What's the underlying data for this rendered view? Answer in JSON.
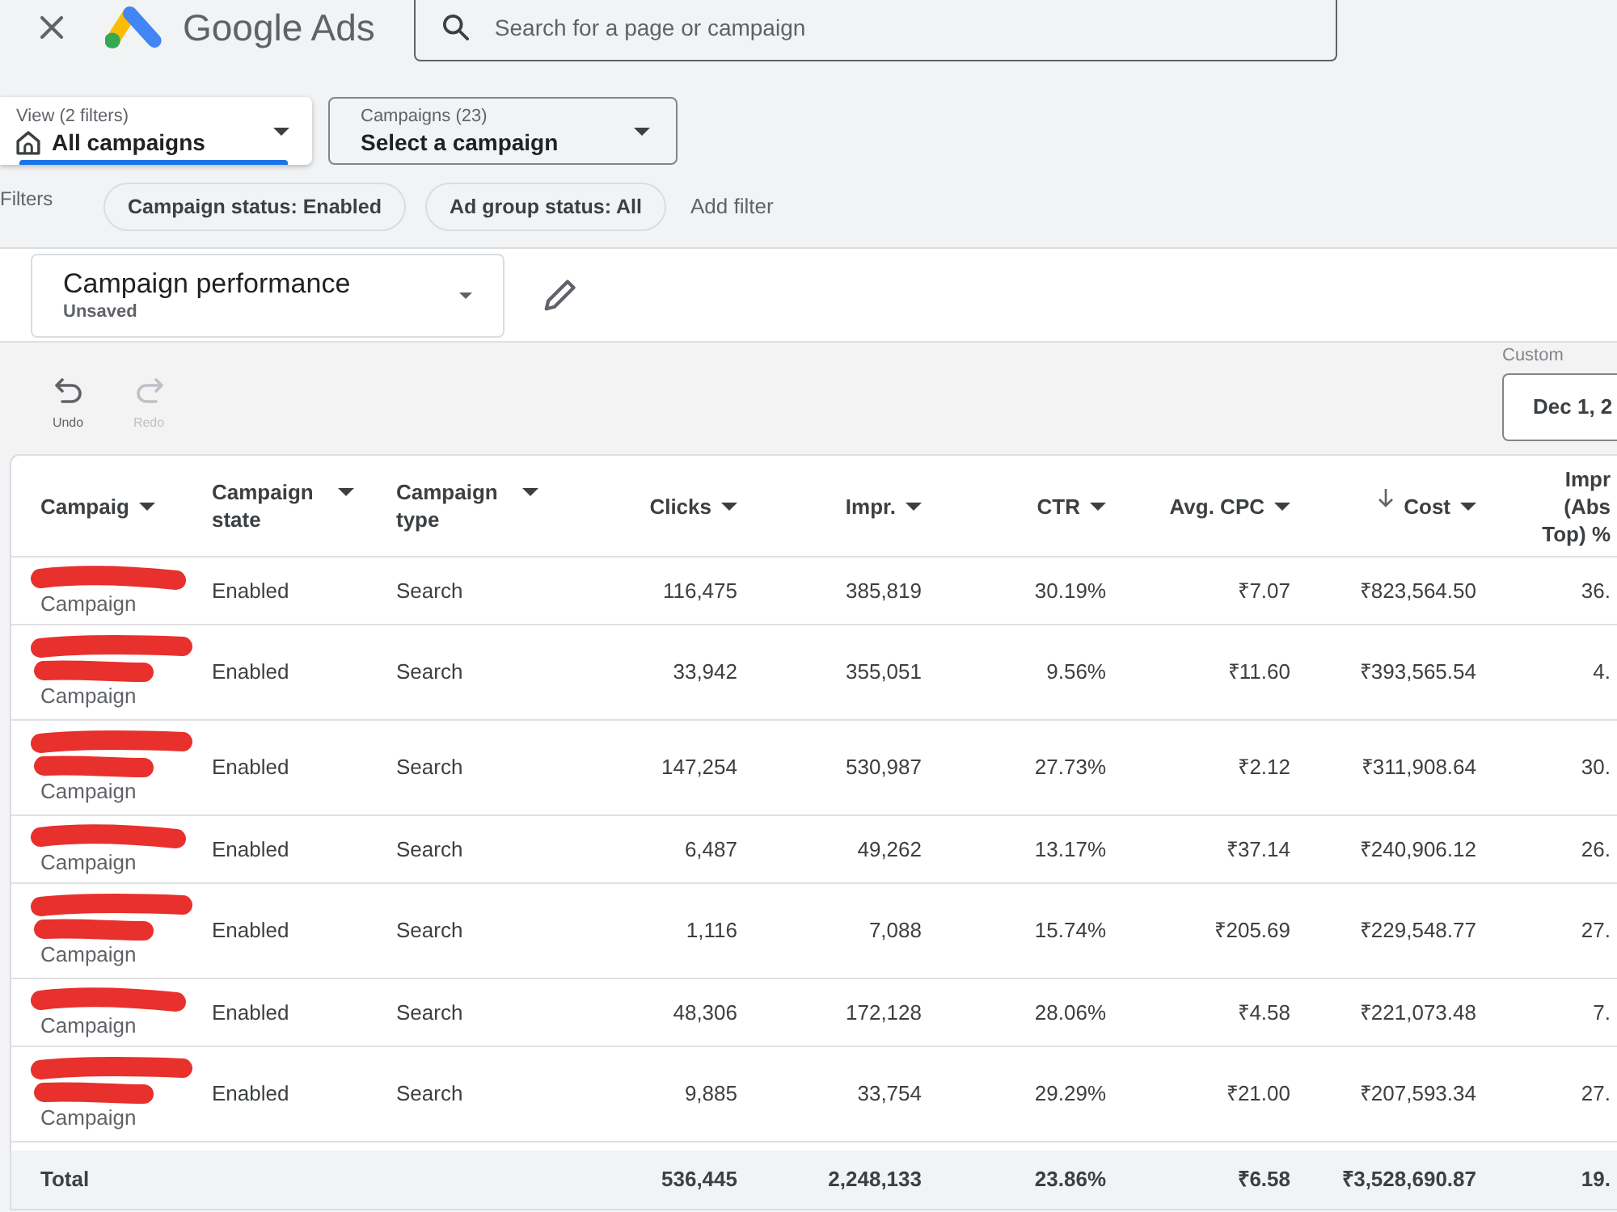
{
  "top_bar": {
    "app_name": "Google Ads",
    "search": {
      "placeholder": "Search for a page or campaign"
    }
  },
  "selectors": [
    {
      "kind": "view",
      "label": "View (2 filters)",
      "value": "All campaigns",
      "selected": true
    },
    {
      "kind": "campaigns",
      "label": "Campaigns (23)",
      "value": "Select a campaign",
      "selected": false
    }
  ],
  "filters": {
    "label": "Filters",
    "chips": [
      "Campaign status: Enabled",
      "Ad group status: All"
    ],
    "add": "Add filter"
  },
  "report": {
    "title": "Campaign performance",
    "subtitle": "Unsaved"
  },
  "toolbar": [
    {
      "kind": "undo",
      "label": "Undo",
      "disabled": false
    },
    {
      "kind": "redo",
      "label": "Redo",
      "disabled": true
    }
  ],
  "date_range": {
    "label": "Custom",
    "value": "Dec 1, 2"
  },
  "table": {
    "columns": [
      {
        "label": "Campaig",
        "kind": "text",
        "sorted": false
      },
      {
        "label": "Campaign state",
        "kind": "text",
        "sorted": false
      },
      {
        "label": "Campaign type",
        "kind": "text",
        "sorted": false
      },
      {
        "label": "Clicks",
        "kind": "number",
        "sorted": false
      },
      {
        "label": "Impr.",
        "kind": "number",
        "sorted": false
      },
      {
        "label": "CTR",
        "kind": "number",
        "sorted": false
      },
      {
        "label": "Avg. CPC",
        "kind": "number",
        "sorted": false
      },
      {
        "label": "Cost",
        "kind": "number",
        "sorted": true
      },
      {
        "label": "Impr (Abs Top) %",
        "kind": "number",
        "sorted": false
      }
    ],
    "rows": [
      {
        "kind": "single",
        "cells": [
          "Campaign",
          "Enabled",
          "Search",
          "116,475",
          "385,819",
          "30.19%",
          "₹7.07",
          "₹823,564.50",
          "36."
        ]
      },
      {
        "kind": "double",
        "cells": [
          "Campaign",
          "Enabled",
          "Search",
          "33,942",
          "355,051",
          "9.56%",
          "₹11.60",
          "₹393,565.54",
          "4."
        ]
      },
      {
        "kind": "double",
        "cells": [
          "Campaign",
          "Enabled",
          "Search",
          "147,254",
          "530,987",
          "27.73%",
          "₹2.12",
          "₹311,908.64",
          "30."
        ]
      },
      {
        "kind": "single",
        "cells": [
          "Campaign",
          "Enabled",
          "Search",
          "6,487",
          "49,262",
          "13.17%",
          "₹37.14",
          "₹240,906.12",
          "26."
        ]
      },
      {
        "kind": "double",
        "cells": [
          "Campaign",
          "Enabled",
          "Search",
          "1,116",
          "7,088",
          "15.74%",
          "₹205.69",
          "₹229,548.77",
          "27."
        ]
      },
      {
        "kind": "single",
        "cells": [
          "Campaign",
          "Enabled",
          "Search",
          "48,306",
          "172,128",
          "28.06%",
          "₹4.58",
          "₹221,073.48",
          "7."
        ]
      },
      {
        "kind": "double",
        "cells": [
          "Campaign",
          "Enabled",
          "Search",
          "9,885",
          "33,754",
          "29.29%",
          "₹21.00",
          "₹207,593.34",
          "27."
        ]
      }
    ],
    "total": {
      "label": "Total",
      "values": [
        "536,445",
        "2,248,133",
        "23.86%",
        "₹6.58",
        "₹3,528,690.87",
        "19."
      ]
    }
  }
}
